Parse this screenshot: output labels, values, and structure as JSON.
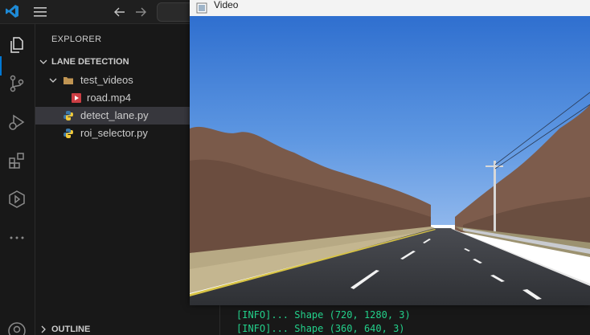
{
  "titlebar": {
    "logo_icon": "vscode-logo-icon",
    "menu_icon": "hamburger-icon",
    "back_icon": "arrow-left-icon",
    "forward_icon": "arrow-right-icon"
  },
  "activity_bar": {
    "items": [
      "explorer-icon",
      "source-control-icon",
      "run-debug-icon",
      "extensions-icon",
      "remote-icon",
      "more-icon",
      "account-icon"
    ],
    "accent_color": "#0078d4"
  },
  "sidebar": {
    "title": "EXPLORER",
    "project_name": "LANE DETECTION",
    "tree": [
      {
        "label": "test_videos",
        "type": "folder"
      },
      {
        "label": "road.mp4",
        "type": "video"
      },
      {
        "label": "detect_lane.py",
        "type": "python",
        "selected": true
      },
      {
        "label": "roi_selector.py",
        "type": "python"
      }
    ],
    "outline_label": "OUTLINE"
  },
  "video_window": {
    "title": "Video"
  },
  "terminal": {
    "lines": [
      "[INFO]... Shape (720, 1280, 3)",
      "[INFO]... Shape (360, 640, 3)"
    ],
    "text_color": "#23d18b"
  }
}
